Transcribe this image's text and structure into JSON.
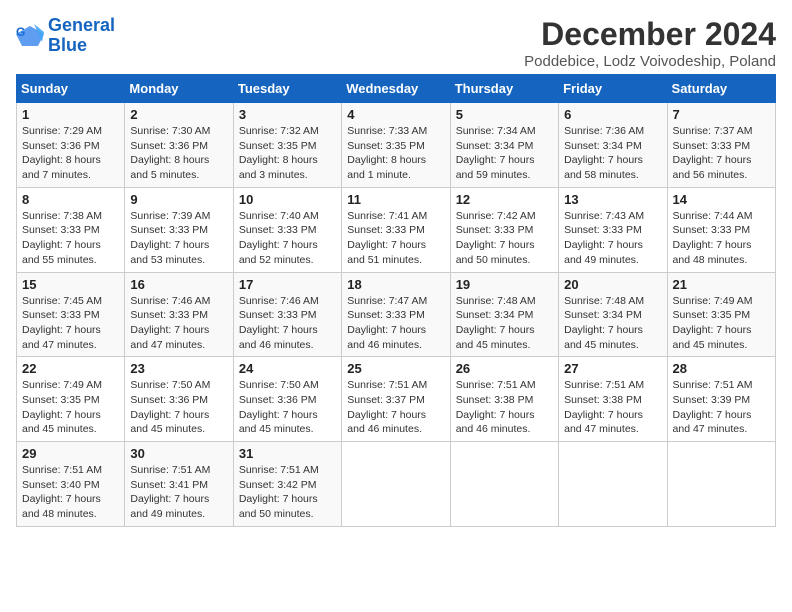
{
  "header": {
    "logo_line1": "General",
    "logo_line2": "Blue",
    "title": "December 2024",
    "subtitle": "Poddebice, Lodz Voivodeship, Poland"
  },
  "weekdays": [
    "Sunday",
    "Monday",
    "Tuesday",
    "Wednesday",
    "Thursday",
    "Friday",
    "Saturday"
  ],
  "weeks": [
    [
      {
        "day": "1",
        "info": "Sunrise: 7:29 AM\nSunset: 3:36 PM\nDaylight: 8 hours\nand 7 minutes."
      },
      {
        "day": "2",
        "info": "Sunrise: 7:30 AM\nSunset: 3:36 PM\nDaylight: 8 hours\nand 5 minutes."
      },
      {
        "day": "3",
        "info": "Sunrise: 7:32 AM\nSunset: 3:35 PM\nDaylight: 8 hours\nand 3 minutes."
      },
      {
        "day": "4",
        "info": "Sunrise: 7:33 AM\nSunset: 3:35 PM\nDaylight: 8 hours\nand 1 minute."
      },
      {
        "day": "5",
        "info": "Sunrise: 7:34 AM\nSunset: 3:34 PM\nDaylight: 7 hours\nand 59 minutes."
      },
      {
        "day": "6",
        "info": "Sunrise: 7:36 AM\nSunset: 3:34 PM\nDaylight: 7 hours\nand 58 minutes."
      },
      {
        "day": "7",
        "info": "Sunrise: 7:37 AM\nSunset: 3:33 PM\nDaylight: 7 hours\nand 56 minutes."
      }
    ],
    [
      {
        "day": "8",
        "info": "Sunrise: 7:38 AM\nSunset: 3:33 PM\nDaylight: 7 hours\nand 55 minutes."
      },
      {
        "day": "9",
        "info": "Sunrise: 7:39 AM\nSunset: 3:33 PM\nDaylight: 7 hours\nand 53 minutes."
      },
      {
        "day": "10",
        "info": "Sunrise: 7:40 AM\nSunset: 3:33 PM\nDaylight: 7 hours\nand 52 minutes."
      },
      {
        "day": "11",
        "info": "Sunrise: 7:41 AM\nSunset: 3:33 PM\nDaylight: 7 hours\nand 51 minutes."
      },
      {
        "day": "12",
        "info": "Sunrise: 7:42 AM\nSunset: 3:33 PM\nDaylight: 7 hours\nand 50 minutes."
      },
      {
        "day": "13",
        "info": "Sunrise: 7:43 AM\nSunset: 3:33 PM\nDaylight: 7 hours\nand 49 minutes."
      },
      {
        "day": "14",
        "info": "Sunrise: 7:44 AM\nSunset: 3:33 PM\nDaylight: 7 hours\nand 48 minutes."
      }
    ],
    [
      {
        "day": "15",
        "info": "Sunrise: 7:45 AM\nSunset: 3:33 PM\nDaylight: 7 hours\nand 47 minutes."
      },
      {
        "day": "16",
        "info": "Sunrise: 7:46 AM\nSunset: 3:33 PM\nDaylight: 7 hours\nand 47 minutes."
      },
      {
        "day": "17",
        "info": "Sunrise: 7:46 AM\nSunset: 3:33 PM\nDaylight: 7 hours\nand 46 minutes."
      },
      {
        "day": "18",
        "info": "Sunrise: 7:47 AM\nSunset: 3:33 PM\nDaylight: 7 hours\nand 46 minutes."
      },
      {
        "day": "19",
        "info": "Sunrise: 7:48 AM\nSunset: 3:34 PM\nDaylight: 7 hours\nand 45 minutes."
      },
      {
        "day": "20",
        "info": "Sunrise: 7:48 AM\nSunset: 3:34 PM\nDaylight: 7 hours\nand 45 minutes."
      },
      {
        "day": "21",
        "info": "Sunrise: 7:49 AM\nSunset: 3:35 PM\nDaylight: 7 hours\nand 45 minutes."
      }
    ],
    [
      {
        "day": "22",
        "info": "Sunrise: 7:49 AM\nSunset: 3:35 PM\nDaylight: 7 hours\nand 45 minutes."
      },
      {
        "day": "23",
        "info": "Sunrise: 7:50 AM\nSunset: 3:36 PM\nDaylight: 7 hours\nand 45 minutes."
      },
      {
        "day": "24",
        "info": "Sunrise: 7:50 AM\nSunset: 3:36 PM\nDaylight: 7 hours\nand 45 minutes."
      },
      {
        "day": "25",
        "info": "Sunrise: 7:51 AM\nSunset: 3:37 PM\nDaylight: 7 hours\nand 46 minutes."
      },
      {
        "day": "26",
        "info": "Sunrise: 7:51 AM\nSunset: 3:38 PM\nDaylight: 7 hours\nand 46 minutes."
      },
      {
        "day": "27",
        "info": "Sunrise: 7:51 AM\nSunset: 3:38 PM\nDaylight: 7 hours\nand 47 minutes."
      },
      {
        "day": "28",
        "info": "Sunrise: 7:51 AM\nSunset: 3:39 PM\nDaylight: 7 hours\nand 47 minutes."
      }
    ],
    [
      {
        "day": "29",
        "info": "Sunrise: 7:51 AM\nSunset: 3:40 PM\nDaylight: 7 hours\nand 48 minutes."
      },
      {
        "day": "30",
        "info": "Sunrise: 7:51 AM\nSunset: 3:41 PM\nDaylight: 7 hours\nand 49 minutes."
      },
      {
        "day": "31",
        "info": "Sunrise: 7:51 AM\nSunset: 3:42 PM\nDaylight: 7 hours\nand 50 minutes."
      },
      {
        "day": "",
        "info": ""
      },
      {
        "day": "",
        "info": ""
      },
      {
        "day": "",
        "info": ""
      },
      {
        "day": "",
        "info": ""
      }
    ]
  ]
}
